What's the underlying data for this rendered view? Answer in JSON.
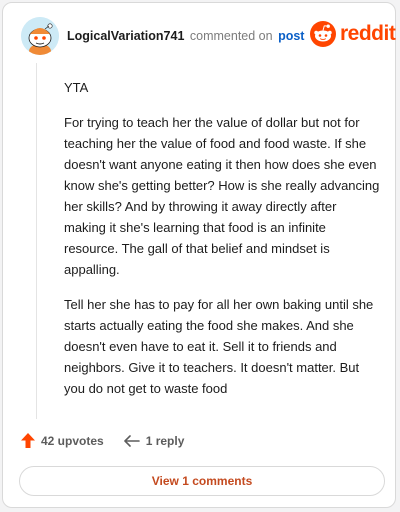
{
  "header": {
    "username": "LogicalVariation741",
    "commented_text": "commented on",
    "post_link": "post",
    "brand_name": "reddit",
    "brand_color": "#ff4500"
  },
  "comment": {
    "paragraphs": [
      "YTA",
      "For trying to teach her the value of dollar but not for teaching her the value of food and food waste. If she doesn't want anyone eating it then how does she even know she's getting better? How is she really advancing her skills? And by throwing it away directly after making it she's learning that food is an infinite resource. The gall of that belief and mindset is appalling.",
      "Tell her she has to pay for all her own baking until she starts actually eating the food she makes. And she doesn't even have to eat it. Sell it to friends and neighbors. Give it to teachers. It doesn't matter. But you do not get to waste food"
    ]
  },
  "actions": {
    "upvotes_label": "42 upvotes",
    "reply_label": "1 reply",
    "upvote_icon": "upvote-arrow-icon",
    "reply_icon": "reply-arrow-icon",
    "upvote_color": "#ff4500"
  },
  "footer": {
    "view_comments_label": "View 1 comments"
  }
}
